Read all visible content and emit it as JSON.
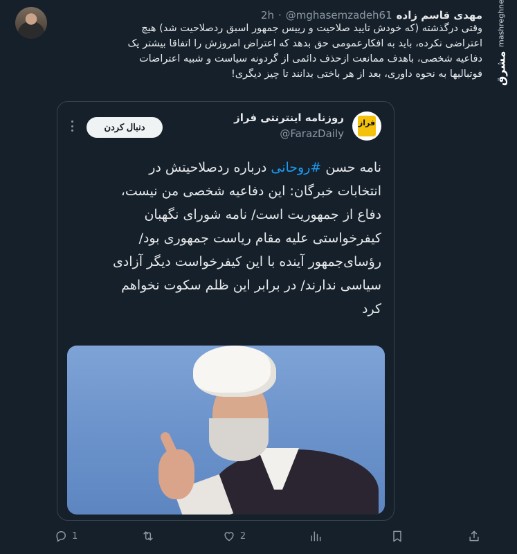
{
  "tweet": {
    "author_name": "مهدی قاسم زاده",
    "handle": "@mghasemzadeh61",
    "separator": "·",
    "time": "2h",
    "text_lines": [
      "وقتی درگذشته (که خودش تایید صلاحیت و رییس جمهور اسبق ردصلاحیت شد) هیچ",
      "اعتراضی نکرده، باید به افکارعمومی حق بدهد که اعتراض امروزش را اتفاقا بیشتر یک",
      "دفاعیه شخصی، باهدف ممانعت ازحذف دائمی از گردونه سیاست و شبیه اعتراضات",
      "فوتبالیها به نحوه داوری، بعد از هر باختی بدانند تا چیز دیگری!"
    ]
  },
  "watermark": {
    "logo": "مشرق",
    "url": "mashreghnews.ir"
  },
  "quote": {
    "display_name": "روزنامه اینترنتی فراز",
    "handle": "@FarazDaily",
    "avatar_text": "فراز",
    "follow_label": "دنبال کردن",
    "text_before_hashtag": "نامه حسن ",
    "hashtag": "#روحانی",
    "text_after_hashtag": " درباره ردصلاحیتش در",
    "text_lines": [
      "انتخابات خبرگان: این دفاعیه شخصی من نیست،",
      "دفاع از جمهوریت است/ نامه شورای نگهبان",
      "کیفرخواستی علیه مقام ریاست جمهوری بود/",
      "رؤسای‌جمهور آینده با این کیفرخواست دیگر آزادی",
      "سیاسی ندارند/ در برابر این ظلم سکوت نخواهم",
      "کرد"
    ]
  },
  "actions": {
    "reply_count": "1",
    "retweet_count": "",
    "like_count": "2",
    "views_count": ""
  }
}
